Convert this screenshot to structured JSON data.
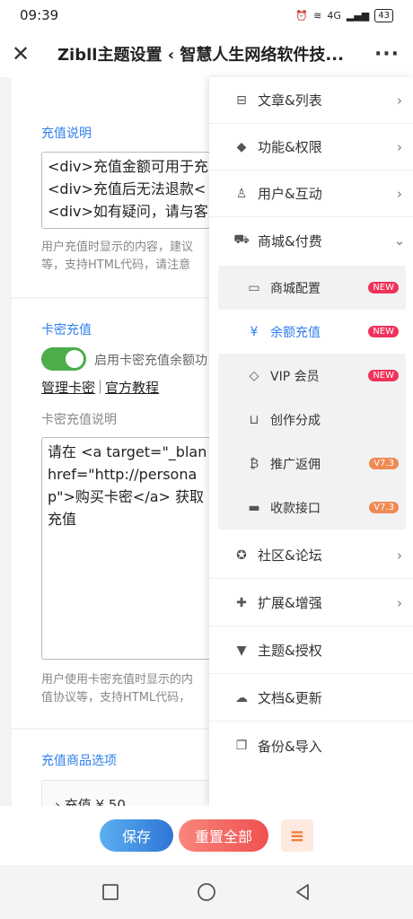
{
  "status": {
    "time": "09:39",
    "battery": "43",
    "network": "4G"
  },
  "header": {
    "title": "Zibll主题设置 ‹ 智慧人生网络软件技..."
  },
  "form": {
    "recharge_desc_label": "充值说明",
    "recharge_desc_value": "<div>充值金额可用于充\n<div>充值后无法退款<\n<div>如有疑问，请与客",
    "recharge_desc_hint": "用户充值时显示的内容，建议\n等，支持HTML代码，请注意",
    "card_label": "卡密充值",
    "card_toggle_label": "启用卡密充值余额功",
    "manage_card": "管理卡密",
    "separator": "|",
    "official_tutorial": "官方教程",
    "card_desc_label": "卡密充值说明",
    "card_desc_value": "请在 <a target=\"_blan\nhref=\"http://persona\np\">购买卡密</a> 获取\n充值",
    "card_desc_hint": "用户使用卡密充值时显示的内\n值协议等，支持HTML代码，",
    "products_label": "充值商品选项",
    "product_item": "› 充值 ¥ 50"
  },
  "menu": {
    "items": [
      {
        "label": "文章&列表",
        "icon": "map-icon",
        "glyph": "⊟",
        "chevron": "›"
      },
      {
        "label": "功能&权限",
        "icon": "shield-icon",
        "glyph": "◆",
        "chevron": "›"
      },
      {
        "label": "用户&互动",
        "icon": "user-icon",
        "glyph": "♙",
        "chevron": "›"
      },
      {
        "label": "商城&付费",
        "icon": "cart-icon",
        "glyph": "⛟",
        "chevron": "⌄"
      }
    ],
    "sub_items": [
      {
        "label": "商城配置",
        "icon": "bag-icon",
        "glyph": "▭",
        "badge": "NEW",
        "badge_color": "#f0325a"
      },
      {
        "label": "余额充值",
        "icon": "yen-icon",
        "glyph": "¥",
        "badge": "NEW",
        "badge_color": "#f0325a"
      },
      {
        "label": "VIP 会员",
        "icon": "diamond-icon",
        "glyph": "◇",
        "badge": "NEW",
        "badge_color": "#f0325a"
      },
      {
        "label": "创作分成",
        "icon": "inbox-icon",
        "glyph": "⊔",
        "badge": "",
        "badge_color": ""
      },
      {
        "label": "推广返佣",
        "icon": "bitcoin-icon",
        "glyph": "₿",
        "badge": "V7.3",
        "badge_color": "#f08a52"
      },
      {
        "label": "收款接口",
        "icon": "credit-card-icon",
        "glyph": "▬",
        "badge": "V7.3",
        "badge_color": "#f08a52"
      }
    ],
    "items_after": [
      {
        "label": "社区&论坛",
        "icon": "forum-icon",
        "glyph": "✪",
        "chevron": "›"
      },
      {
        "label": "扩展&增强",
        "icon": "puzzle-icon",
        "glyph": "✚",
        "chevron": "›"
      },
      {
        "label": "主题&授权",
        "icon": "brand-icon",
        "glyph": "▼",
        "chevron": ""
      },
      {
        "label": "文档&更新",
        "icon": "cloud-upload-icon",
        "glyph": "☁",
        "chevron": ""
      },
      {
        "label": "备份&导入",
        "icon": "copy-icon",
        "glyph": "❐",
        "chevron": ""
      }
    ]
  },
  "footer": {
    "save": "保存",
    "reset": "重置全部",
    "menu_toggle": "≡"
  },
  "colors": {
    "accent": "#2f80ed",
    "toggle": "#4cad4a",
    "save_btn": "#3d8fe0",
    "reset_btn": "#f06464",
    "badge_new": "#f0325a",
    "badge_version": "#f08a52"
  }
}
